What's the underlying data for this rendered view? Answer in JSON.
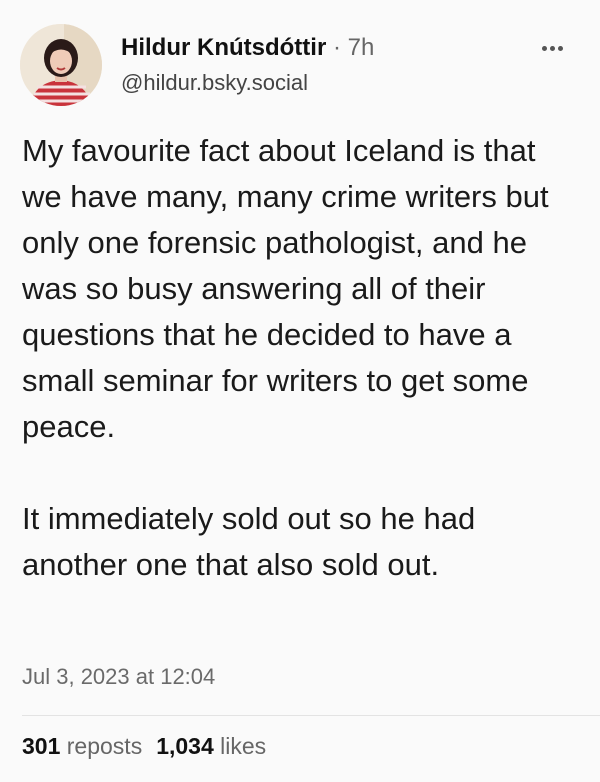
{
  "author": {
    "display_name": "Hildur Knútsdóttir",
    "time_suffix": " · 7h",
    "handle": "@hildur.bsky.social",
    "avatar_icon": "profile-photo"
  },
  "menu": {
    "icon": "more-options-icon"
  },
  "post": {
    "paragraph_1": "My favourite fact about Iceland is that we have many, many crime writers but only one forensic pathologist, and he was so busy answering all of their questions that he decided to have a small seminar for writers to get some peace.",
    "paragraph_2": "It immediately sold out so he had another one that also sold out.",
    "timestamp": "Jul 3, 2023 at 12:04"
  },
  "stats": {
    "reposts_count": "301",
    "reposts_label": " reposts",
    "likes_count": "1,034",
    "likes_label": " likes"
  }
}
